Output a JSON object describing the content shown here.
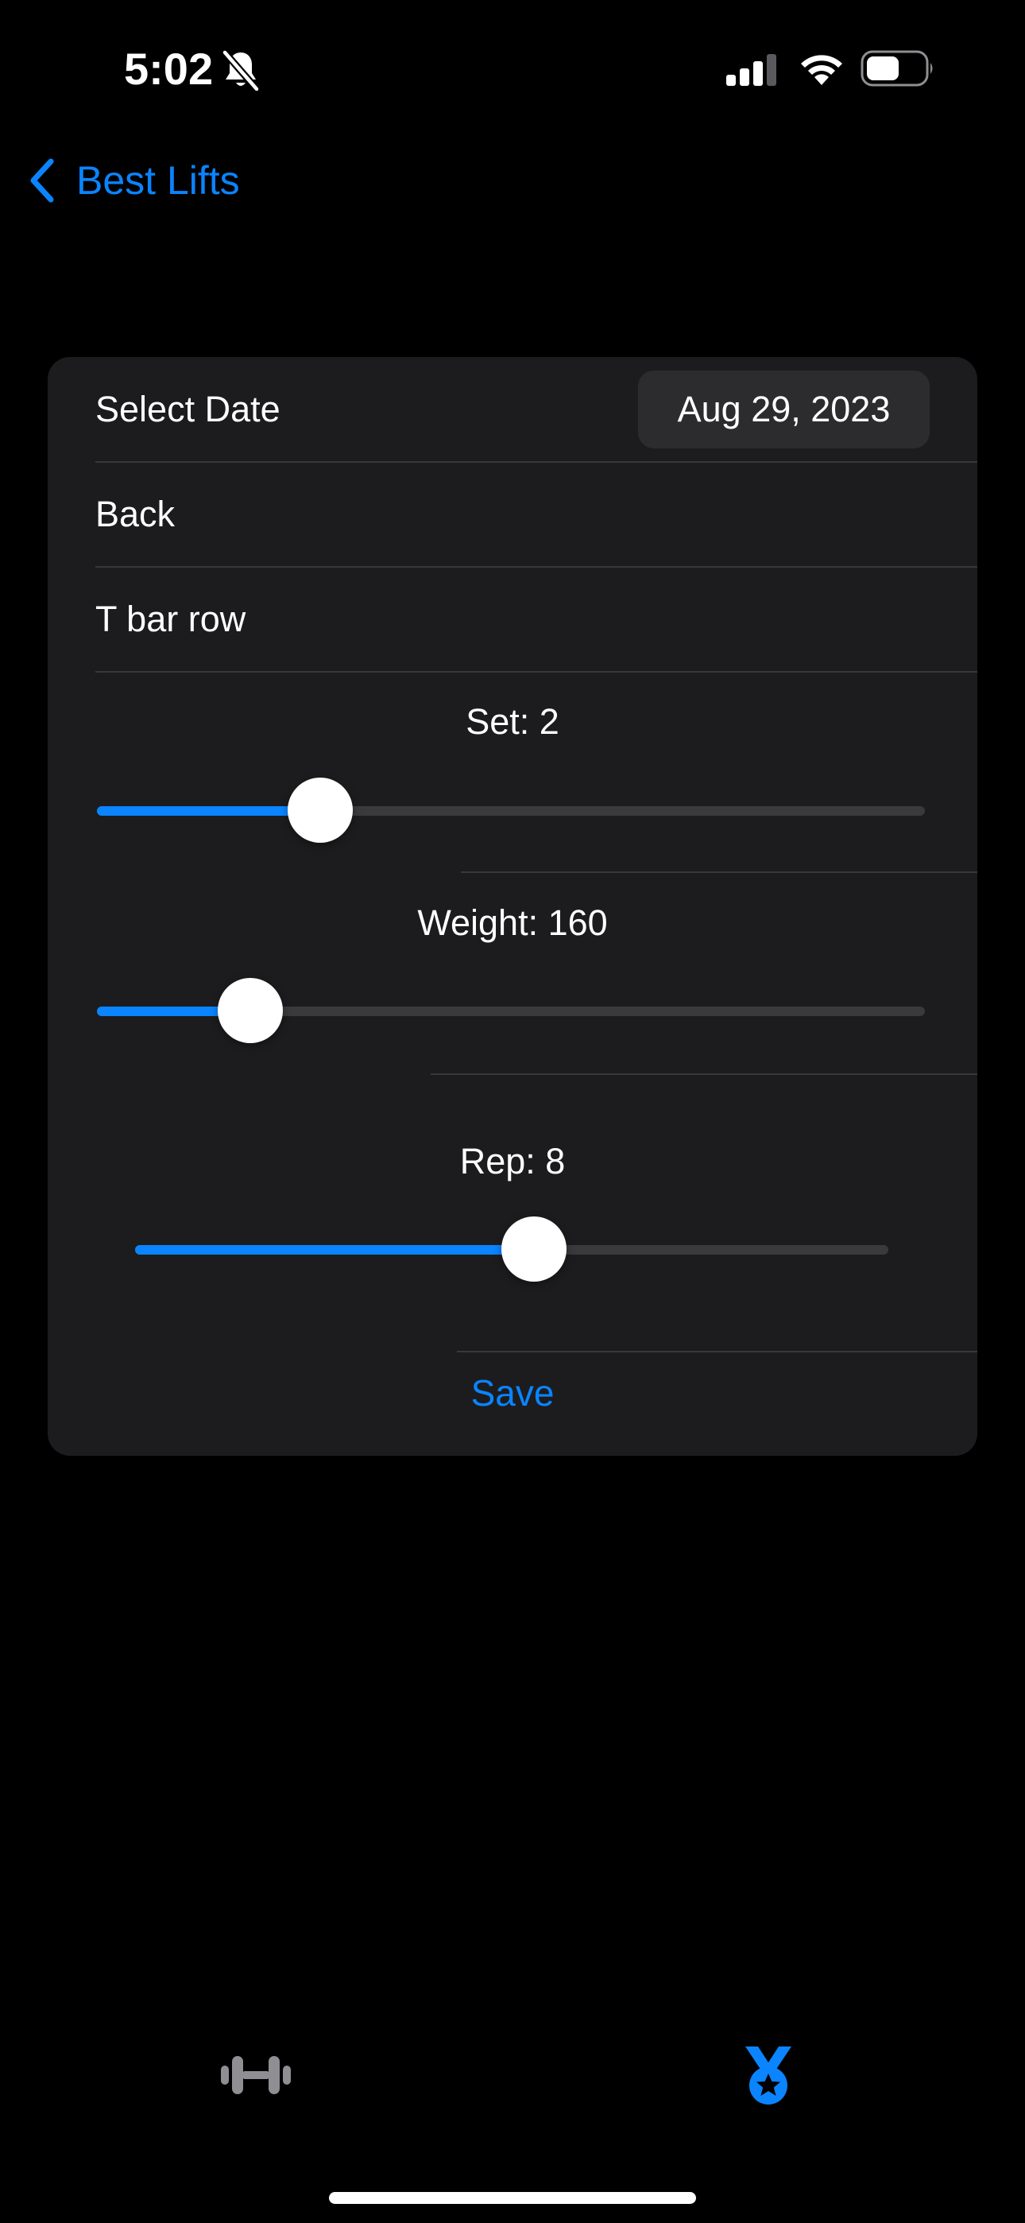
{
  "status_bar": {
    "time": "5:02",
    "icons": [
      "bell-slash-icon",
      "cellular-signal-icon",
      "wifi-icon",
      "battery-icon"
    ]
  },
  "nav": {
    "back_label": "Best Lifts",
    "back_icon": "chevron-left-icon"
  },
  "form": {
    "date_label": "Select Date",
    "date_value": "Aug 29, 2023",
    "muscle_group": "Back",
    "exercise": "T bar row",
    "sliders": {
      "set": {
        "label": "Set: 2",
        "level_fraction": 0.27
      },
      "weight": {
        "label": "Weight: 160",
        "level_fraction": 0.185
      },
      "rep": {
        "label": "Rep: 8",
        "level_fraction": 0.53
      }
    },
    "save_label": "Save"
  },
  "tab_bar": {
    "tabs": [
      {
        "icon": "dumbbell-icon",
        "selected": false
      },
      {
        "icon": "medal-icon",
        "selected": true
      }
    ]
  },
  "colors": {
    "accent": "#0a84ff",
    "background": "#000000",
    "card": "#1c1c1e",
    "inactive_tab": "#8e8e93"
  }
}
